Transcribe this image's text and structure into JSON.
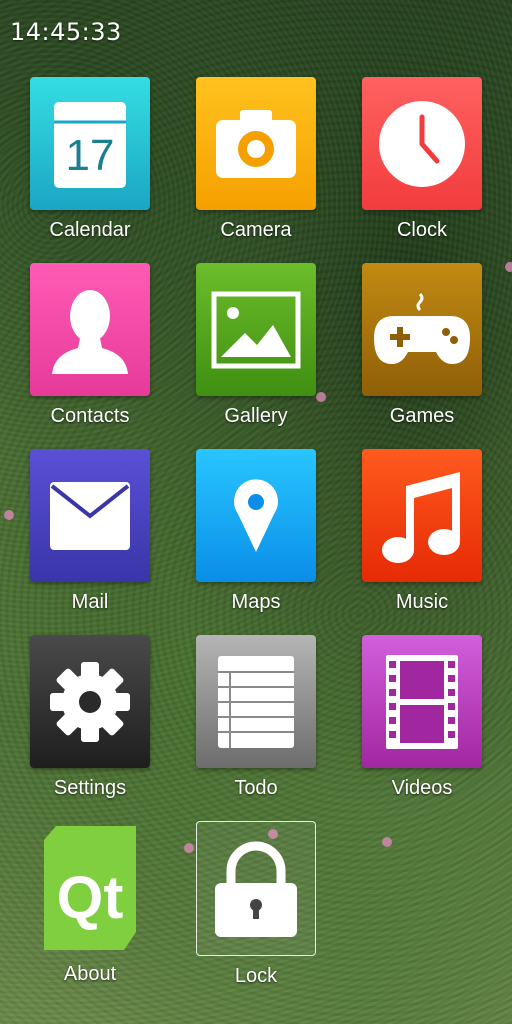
{
  "status": {
    "time": "14:45:33"
  },
  "apps": [
    {
      "id": "calendar",
      "label": "Calendar",
      "icon": "calendar-icon",
      "color_top": "#35dde2",
      "color_bottom": "#1aa6c4",
      "badge": "17"
    },
    {
      "id": "camera",
      "label": "Camera",
      "icon": "camera-icon",
      "color_top": "#ffc21e",
      "color_bottom": "#f5a000"
    },
    {
      "id": "clock",
      "label": "Clock",
      "icon": "clock-icon",
      "color_top": "#ff6161",
      "color_bottom": "#f23c3c"
    },
    {
      "id": "contacts",
      "label": "Contacts",
      "icon": "person-icon",
      "color_top": "#ff5bb4",
      "color_bottom": "#e63a9a"
    },
    {
      "id": "gallery",
      "label": "Gallery",
      "icon": "picture-icon",
      "color_top": "#6cbd2a",
      "color_bottom": "#3f8f12"
    },
    {
      "id": "games",
      "label": "Games",
      "icon": "gamepad-icon",
      "color_top": "#c28a12",
      "color_bottom": "#8f5f08"
    },
    {
      "id": "mail",
      "label": "Mail",
      "icon": "envelope-icon",
      "color_top": "#5a50d6",
      "color_bottom": "#3a35a8"
    },
    {
      "id": "maps",
      "label": "Maps",
      "icon": "map-pin-icon",
      "color_top": "#28c6ff",
      "color_bottom": "#0a8ee8"
    },
    {
      "id": "music",
      "label": "Music",
      "icon": "music-note-icon",
      "color_top": "#ff5a1e",
      "color_bottom": "#e62a05"
    },
    {
      "id": "settings",
      "label": "Settings",
      "icon": "gear-icon",
      "color_top": "#4a4a4a",
      "color_bottom": "#1e1e1e"
    },
    {
      "id": "todo",
      "label": "Todo",
      "icon": "list-icon",
      "color_top": "#b5b5b5",
      "color_bottom": "#6d6d6d"
    },
    {
      "id": "videos",
      "label": "Videos",
      "icon": "film-icon",
      "color_top": "#d35fdc",
      "color_bottom": "#a0279f"
    },
    {
      "id": "about",
      "label": "About",
      "icon": "qt-logo-icon",
      "color_top": "#7fcf3f",
      "color_bottom": "#5ea82a",
      "logo_text": "Qt"
    },
    {
      "id": "lock",
      "label": "Lock",
      "icon": "padlock-icon",
      "color_top": "transparent",
      "color_bottom": "transparent"
    }
  ]
}
